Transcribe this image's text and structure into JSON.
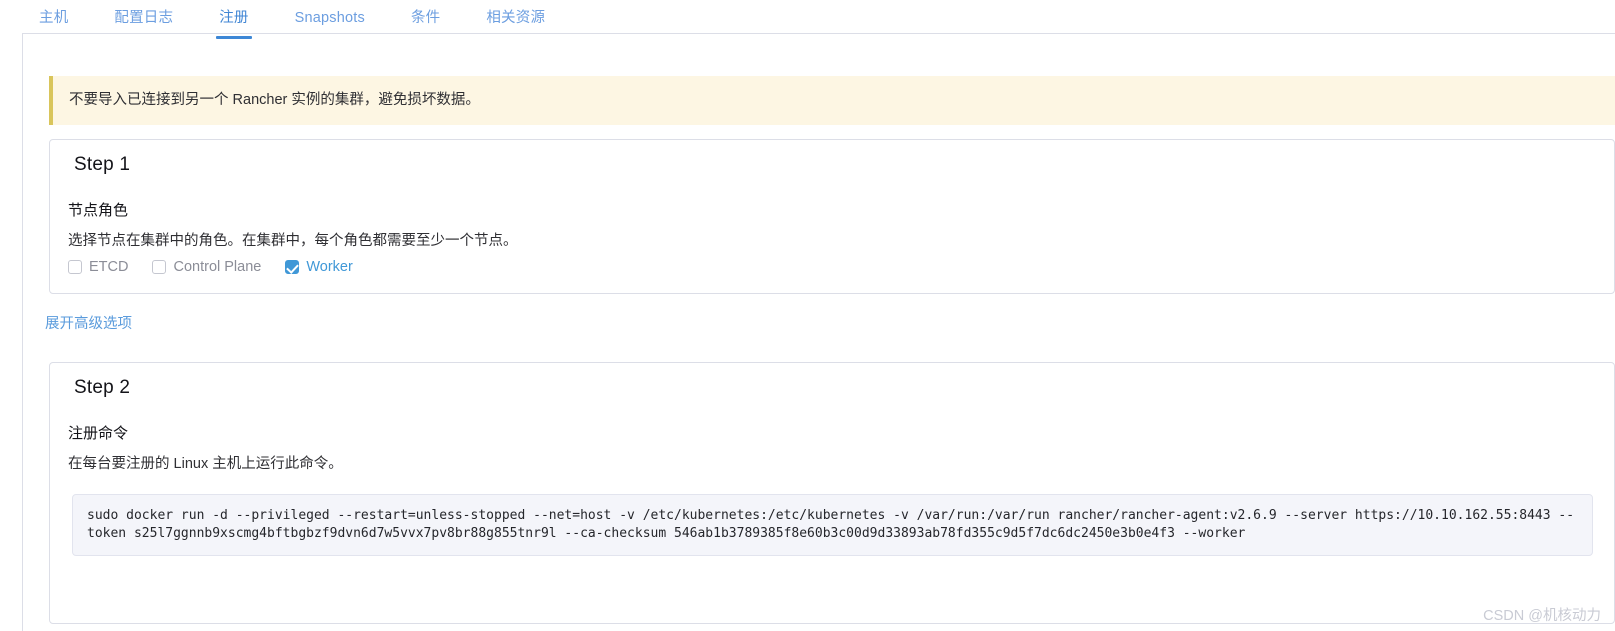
{
  "tabs": [
    {
      "label": "主机",
      "active": false
    },
    {
      "label": "配置日志",
      "active": false
    },
    {
      "label": "注册",
      "active": true
    },
    {
      "label": "Snapshots",
      "active": false
    },
    {
      "label": "条件",
      "active": false
    },
    {
      "label": "相关资源",
      "active": false
    }
  ],
  "banner": {
    "text": "不要导入已连接到另一个 Rancher 实例的集群，避免损坏数据。"
  },
  "step1": {
    "title": "Step 1",
    "section_label": "节点角色",
    "section_desc": "选择节点在集群中的角色。在集群中，每个角色都需要至少一个节点。",
    "roles": [
      {
        "label": "ETCD",
        "checked": false
      },
      {
        "label": "Control Plane",
        "checked": false
      },
      {
        "label": "Worker",
        "checked": true
      }
    ]
  },
  "advanced_link": {
    "label": "展开高级选项"
  },
  "step2": {
    "title": "Step 2",
    "section_label": "注册命令",
    "section_desc": "在每台要注册的 Linux 主机上运行此命令。",
    "command": "sudo docker run -d --privileged --restart=unless-stopped --net=host -v /etc/kubernetes:/etc/kubernetes -v /var/run:/var/run rancher/rancher-agent:v2.6.9 --server https://10.10.162.55:8443 --token s25l7ggnnb9xscmg4bftbgbzf9dvn6d7w5vvx7pv8br88g855tnr9l --ca-checksum 546ab1b3789385f8e60b3c00d9d33893ab78fd355c9d5f7dc6dc2450e3b0e4f3 --worker"
  },
  "watermark": {
    "text": "CSDN @机核动力"
  },
  "colors": {
    "accent_blue": "#3d87d6",
    "tab_blue": "#6c9ee0",
    "checkbox_blue": "#4098d7",
    "banner_bg": "#fdf6e3",
    "banner_border": "#d9c55b",
    "panel_border": "#dcdee7",
    "code_bg": "#f4f5fa",
    "watermark_gray": "#c9cbd4"
  }
}
